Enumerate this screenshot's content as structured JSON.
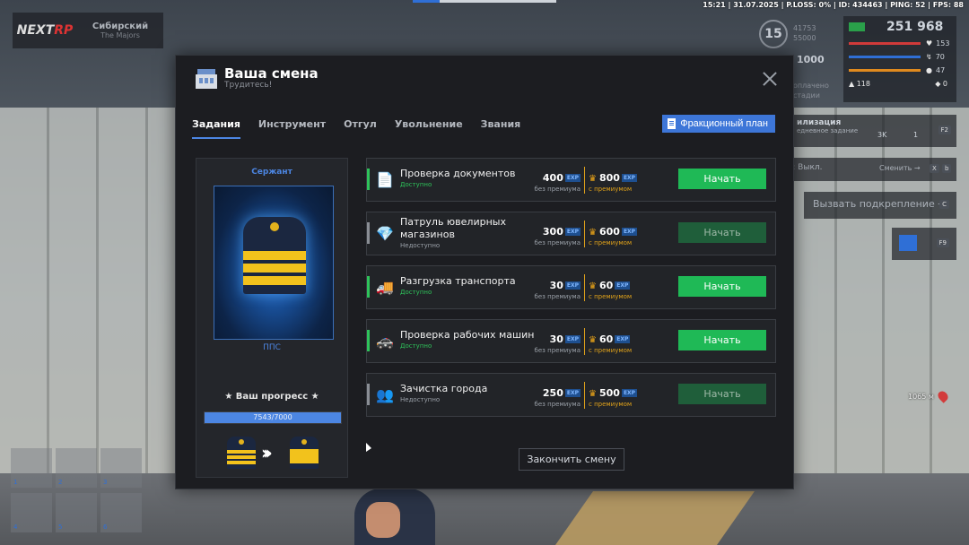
{
  "status_bar": {
    "text": "15:21 | 31.07.2025 | P.LOSS: 0% | ID: 434463 | PING: 52 | FPS: 88"
  },
  "server": {
    "brand_main": "NEXT",
    "brand_accent": "RP",
    "name": "Сибирский",
    "faction": "The Majors"
  },
  "hud": {
    "level": "15",
    "xp_current": "41753",
    "xp_total": "55000",
    "money": "251 968",
    "stats": [
      {
        "value": "153",
        "color": "#d03a3a"
      },
      {
        "value": "70",
        "color": "#2f6fd6"
      },
      {
        "value": "47",
        "color": "#e08a1e"
      }
    ],
    "armor": "118",
    "wanted": "0",
    "side_value": "1000",
    "side_text_1": "оплачено",
    "side_text_2": "стадии",
    "mobilization_title": "илизация",
    "mobilization_sub": "едневное задание",
    "mobilization_count_1": "3K",
    "mobilization_count_2": "1",
    "key_f2": "F2",
    "radio_label": "ал: Выкл.",
    "radio_switch": "Сменить →",
    "key_x": "X",
    "key_b": "b",
    "backup_label": "Вызвать подкрепление →",
    "key_c": "C",
    "key_f9": "F9",
    "map_marker": "1065 м"
  },
  "inventory": {
    "slots": [
      "1",
      "2",
      "3",
      "4",
      "5",
      "6"
    ]
  },
  "modal": {
    "title": "Ваша смена",
    "subtitle": "Трудитесь!",
    "tabs": [
      {
        "label": "Задания",
        "active": true
      },
      {
        "label": "Инструмент",
        "active": false
      },
      {
        "label": "Отгул",
        "active": false
      },
      {
        "label": "Увольнение",
        "active": false
      },
      {
        "label": "Звания",
        "active": false
      }
    ],
    "fraction_plan_label": "Фракционный план",
    "rank": {
      "name": "Сержант",
      "short": "ППС",
      "progress_title": "★ Ваш прогресс ★",
      "progress_text": "7543/7000",
      "progress_fraction": 1.0
    },
    "tasks": [
      {
        "name": "Проверка документов",
        "status": "Доступно",
        "available": true,
        "base_exp": "400",
        "premium_exp": "800",
        "icon": "documents-icon"
      },
      {
        "name": "Патруль ювелирных магазинов",
        "status": "Недоступно",
        "available": false,
        "base_exp": "300",
        "premium_exp": "600",
        "icon": "jewelry-icon"
      },
      {
        "name": "Разгрузка транспорта",
        "status": "Доступно",
        "available": true,
        "base_exp": "30",
        "premium_exp": "60",
        "icon": "forklift-icon"
      },
      {
        "name": "Проверка рабочих машин",
        "status": "Доступно",
        "available": true,
        "base_exp": "30",
        "premium_exp": "60",
        "icon": "car-icon"
      },
      {
        "name": "Зачистка города",
        "status": "Недоступно",
        "available": false,
        "base_exp": "250",
        "premium_exp": "500",
        "icon": "people-icon"
      }
    ],
    "exp_badge": "EXP",
    "no_premium_label": "без премиума",
    "with_premium_label": "с премиумом",
    "start_label": "Начать",
    "finish_label": "Закончить смену"
  },
  "colors": {
    "accent_blue": "#4c86e3",
    "start_enabled": "#1fb956",
    "start_disabled": "#1f5e3a",
    "available_green": "#2ec35a",
    "premium_gold": "#e0a21a"
  }
}
